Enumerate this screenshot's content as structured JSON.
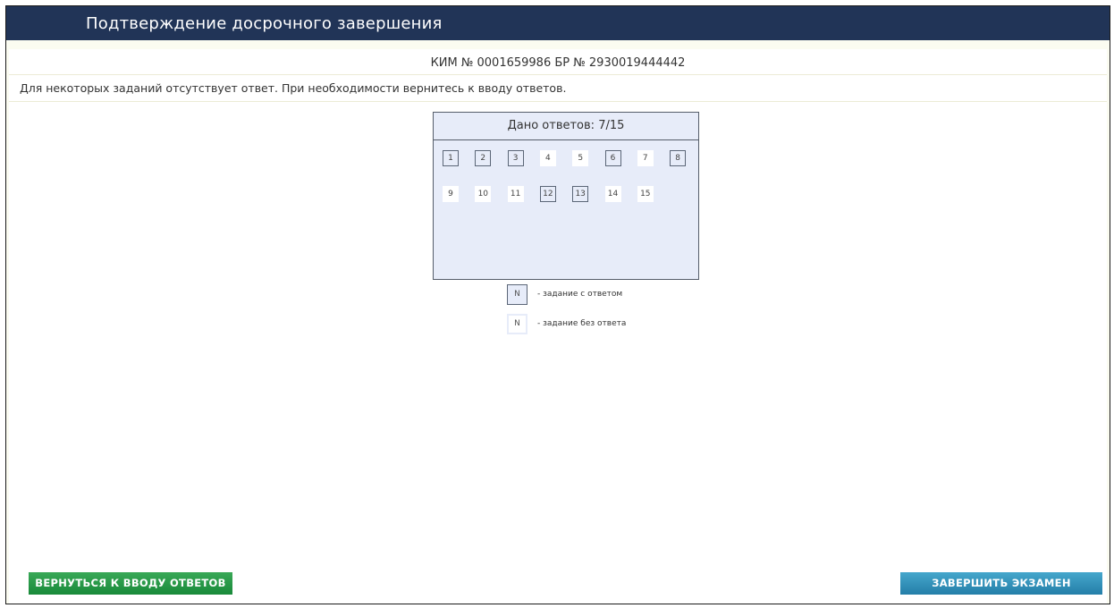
{
  "window": {
    "title": "Подтверждение досрочного завершения"
  },
  "header": {
    "kim_line": "КИМ № 0001659986 БР № 2930019444442",
    "notice": "Для некоторых заданий отсутствует ответ. При необходимости вернитесь к вводу ответов."
  },
  "panel": {
    "title": "Дано ответов: 7/15",
    "answered_count": 7,
    "total": 15,
    "tasks": [
      {
        "label": "1",
        "answered": true
      },
      {
        "label": "2",
        "answered": true
      },
      {
        "label": "3",
        "answered": true
      },
      {
        "label": "4",
        "answered": false
      },
      {
        "label": "5",
        "answered": false
      },
      {
        "label": "6",
        "answered": true
      },
      {
        "label": "7",
        "answered": false
      },
      {
        "label": "8",
        "answered": true
      },
      {
        "label": "9",
        "answered": false
      },
      {
        "label": "10",
        "answered": false
      },
      {
        "label": "11",
        "answered": false
      },
      {
        "label": "12",
        "answered": true
      },
      {
        "label": "13",
        "answered": true
      },
      {
        "label": "14",
        "answered": false
      },
      {
        "label": "15",
        "answered": false
      }
    ]
  },
  "legend": {
    "answered": {
      "symbol": "N",
      "text": "- задание с ответом"
    },
    "unanswered": {
      "symbol": "N",
      "text": "- задание без ответа"
    }
  },
  "buttons": {
    "back": "ВЕРНУТЬСЯ К ВВОДУ ОТВЕТОВ",
    "finish": "ЗАВЕРШИТЬ ЭКЗАМЕН"
  },
  "colors": {
    "title_bar": "#213457",
    "back_button": "#22913f",
    "finish_button": "#2f8fb9",
    "panel_fill": "#e7ecf9"
  }
}
